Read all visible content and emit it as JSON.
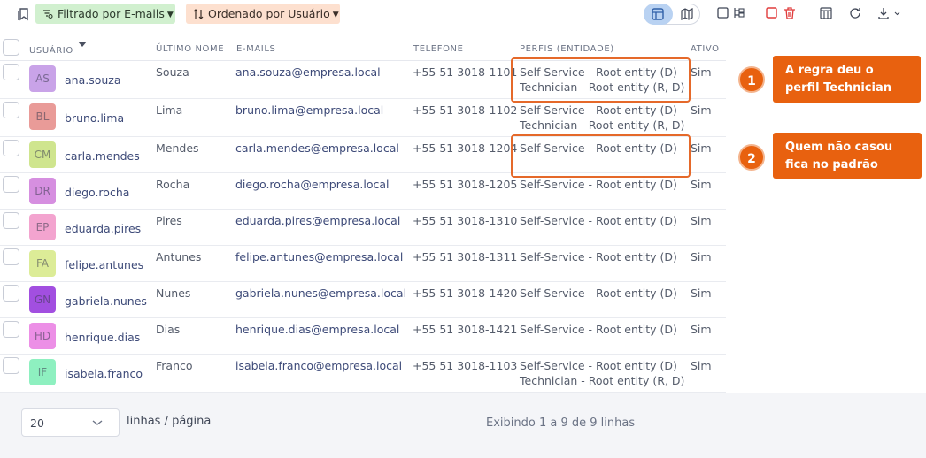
{
  "toolbar": {
    "filter_label": "Filtrado por E-mails",
    "sort_label": "Ordenado por Usuário"
  },
  "table": {
    "columns": {
      "user": "USUÁRIO",
      "last_name": "ÚLTIMO NOME",
      "emails": "E-MAILS",
      "phone": "TELEFONE",
      "profiles": "PERFIS (ENTIDADE)",
      "active": "ATIVO"
    },
    "rows": [
      {
        "initials": "AS",
        "avatar_color": "#c9a3e8",
        "user": "ana.souza",
        "last": "Souza",
        "email": "ana.souza@empresa.local",
        "phone": "+55 51 3018-1101",
        "profiles": [
          "Self-Service - Root entity (D)",
          "Technician - Root entity (R, D)"
        ],
        "active": "Sim"
      },
      {
        "initials": "BL",
        "avatar_color": "#e99b98",
        "user": "bruno.lima",
        "last": "Lima",
        "email": "bruno.lima@empresa.local",
        "phone": "+55 51 3018-1102",
        "profiles": [
          "Self-Service - Root entity (D)",
          "Technician - Root entity (R, D)"
        ],
        "active": "Sim"
      },
      {
        "initials": "CM",
        "avatar_color": "#cfe58e",
        "user": "carla.mendes",
        "last": "Mendes",
        "email": "carla.mendes@empresa.local",
        "phone": "+55 51 3018-1204",
        "profiles": [
          "Self-Service - Root entity (D)"
        ],
        "active": "Sim"
      },
      {
        "initials": "DR",
        "avatar_color": "#d68fe0",
        "user": "diego.rocha",
        "last": "Rocha",
        "email": "diego.rocha@empresa.local",
        "phone": "+55 51 3018-1205",
        "profiles": [
          "Self-Service - Root entity (D)"
        ],
        "active": "Sim"
      },
      {
        "initials": "EP",
        "avatar_color": "#f3a4cf",
        "user": "eduarda.pires",
        "last": "Pires",
        "email": "eduarda.pires@empresa.local",
        "phone": "+55 51 3018-1310",
        "profiles": [
          "Self-Service - Root entity (D)"
        ],
        "active": "Sim"
      },
      {
        "initials": "FA",
        "avatar_color": "#dcec97",
        "user": "felipe.antunes",
        "last": "Antunes",
        "email": "felipe.antunes@empresa.local",
        "phone": "+55 51 3018-1311",
        "profiles": [
          "Self-Service - Root entity (D)"
        ],
        "active": "Sim"
      },
      {
        "initials": "GN",
        "avatar_color": "#a24fe0",
        "user": "gabriela.nunes",
        "last": "Nunes",
        "email": "gabriela.nunes@empresa.local",
        "phone": "+55 51 3018-1420",
        "profiles": [
          "Self-Service - Root entity (D)"
        ],
        "active": "Sim"
      },
      {
        "initials": "HD",
        "avatar_color": "#ec8fe6",
        "user": "henrique.dias",
        "last": "Dias",
        "email": "henrique.dias@empresa.local",
        "phone": "+55 51 3018-1421",
        "profiles": [
          "Self-Service - Root entity (D)"
        ],
        "active": "Sim"
      },
      {
        "initials": "IF",
        "avatar_color": "#8ef0c0",
        "user": "isabela.franco",
        "last": "Franco",
        "email": "isabela.franco@empresa.local",
        "phone": "+55 51 3018-1103",
        "profiles": [
          "Self-Service - Root entity (D)",
          "Technician - Root entity (R, D)"
        ],
        "active": "Sim"
      }
    ]
  },
  "callouts": [
    {
      "number": "1",
      "text": "A regra deu o perfil Technician"
    },
    {
      "number": "2",
      "text": "Quem não casou fica no padrão"
    }
  ],
  "footer": {
    "page_size": "20",
    "rows_per_page_label": "linhas / página",
    "info": "Exibindo 1 a 9 de 9 linhas"
  },
  "colors": {
    "accent_orange": "#e8610f",
    "filter_chip": "#d1f0cf",
    "sort_chip": "#fde0cf",
    "view_active": "#b9d2f2",
    "delete_red": "#e03b3b"
  }
}
